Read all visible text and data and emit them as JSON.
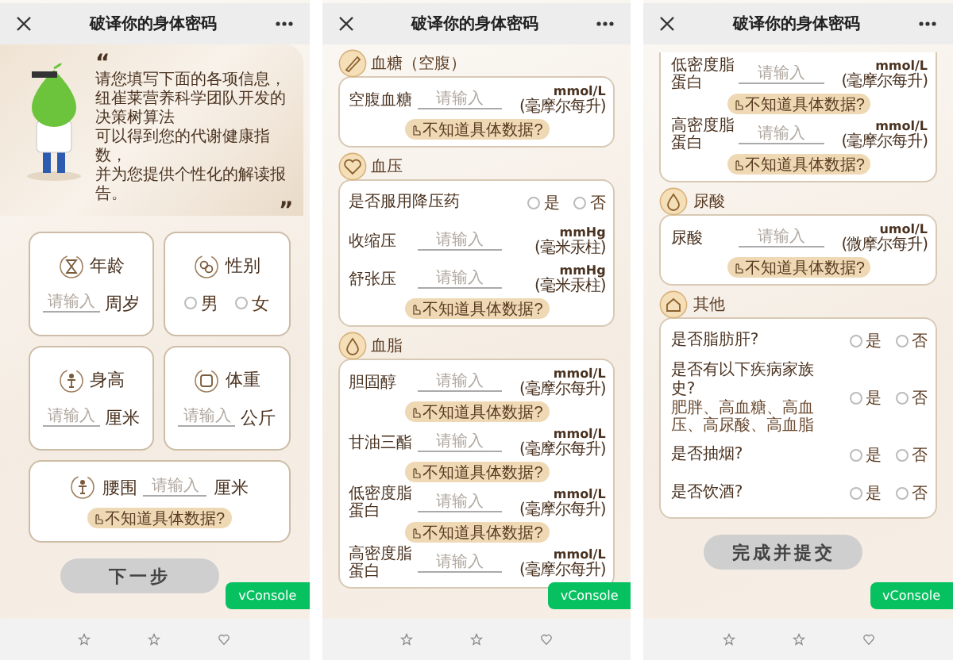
{
  "panels": [
    {
      "kind": "intro",
      "title": "破译你的身体密码",
      "quote_open": "“",
      "quote_close": "”",
      "quote_lines": [
        "请您填写下面的各项信息，",
        "纽崔莱营养科学团队开发的决策树算法",
        "可以得到您的代谢健康指数，",
        "并为您提供个性化的解读报告。"
      ],
      "cards": [
        {
          "kind": "input",
          "label": "年龄",
          "placeholder": "请输入",
          "unit": "周岁"
        },
        {
          "kind": "choice",
          "label": "性别",
          "options": [
            {
              "label": "男",
              "selected": false
            },
            {
              "label": "女",
              "selected": false
            }
          ]
        },
        {
          "kind": "input",
          "label": "身高",
          "placeholder": "请输入",
          "unit": "厘米"
        },
        {
          "kind": "input",
          "label": "体重",
          "placeholder": "请输入",
          "unit": "公斤"
        },
        {
          "kind": "wide_input",
          "label": "腰围",
          "placeholder": "请输入",
          "unit": "厘米",
          "hint": "不知道具体数据?"
        }
      ],
      "button": "下一步",
      "console": "vConsole"
    },
    {
      "kind": "form",
      "title": "破译你的身体密码",
      "sections": [
        {
          "kind": "glucose",
          "title": "血糖（空腹）",
          "rows": [
            {
              "kind": "measure",
              "label": "空腹血糖",
              "placeholder": "请输入",
              "unit": "mmol/L",
              "unit_note": "(毫摩尔每升)",
              "hint": "不知道具体数据?"
            }
          ]
        },
        {
          "kind": "pressure",
          "title": "血压",
          "rows": [
            {
              "kind": "choice",
              "label": "是否服用降压药",
              "options": [
                {
                  "label": "是",
                  "selected": false
                },
                {
                  "label": "否",
                  "selected": false
                }
              ]
            },
            {
              "kind": "measure",
              "label": "收缩压",
              "placeholder": "请输入",
              "unit": "mmHg",
              "unit_note": "(毫米汞柱)"
            },
            {
              "kind": "measure",
              "label": "舒张压",
              "placeholder": "请输入",
              "unit": "mmHg",
              "unit_note": "(毫米汞柱)",
              "hint": "不知道具体数据?"
            }
          ]
        },
        {
          "kind": "lipid",
          "title": "血脂",
          "rows": [
            {
              "kind": "measure",
              "label": "胆固醇",
              "placeholder": "请输入",
              "unit": "mmol/L",
              "unit_note": "(毫摩尔每升)",
              "hint": "不知道具体数据?"
            },
            {
              "kind": "measure",
              "label": "甘油三酯",
              "placeholder": "请输入",
              "unit": "mmol/L",
              "unit_note": "(毫摩尔每升)",
              "hint": "不知道具体数据?"
            },
            {
              "kind": "measure",
              "label": "低密度脂蛋白",
              "placeholder": "请输入",
              "unit": "mmol/L",
              "unit_note": "(毫摩尔每升)",
              "hint": "不知道具体数据?"
            },
            {
              "kind": "measure",
              "label": "高密度脂蛋白",
              "placeholder": "请输入",
              "unit": "mmol/L",
              "unit_note": "(毫摩尔每升)"
            }
          ]
        }
      ],
      "console": "vConsole"
    },
    {
      "kind": "form",
      "title": "破译你的身体密码",
      "sections": [
        {
          "rows": [
            {
              "kind": "measure",
              "label": "低密度脂蛋白",
              "placeholder": "请输入",
              "unit": "mmol/L",
              "unit_note": "(毫摩尔每升)",
              "hint": "不知道具体数据?"
            },
            {
              "kind": "measure",
              "label": "高密度脂蛋白",
              "placeholder": "请输入",
              "unit": "mmol/L",
              "unit_note": "(毫摩尔每升)",
              "hint": "不知道具体数据?"
            }
          ]
        },
        {
          "kind": "uric",
          "title": "尿酸",
          "rows": [
            {
              "kind": "measure",
              "label": "尿酸",
              "placeholder": "请输入",
              "unit": "umol/L",
              "unit_note": "(微摩尔每升)",
              "hint": "不知道具体数据?"
            }
          ]
        },
        {
          "kind": "other",
          "title": "其他",
          "rows": [
            {
              "kind": "choice",
              "label": "是否脂肪肝?",
              "options": [
                {
                  "label": "是",
                  "selected": false
                },
                {
                  "label": "否",
                  "selected": false
                }
              ]
            },
            {
              "kind": "choice",
              "label": "是否有以下疾病家族史?",
              "note": "肥胖、高血糖、高血压、高尿酸、高血脂",
              "options": [
                {
                  "label": "是",
                  "selected": false
                },
                {
                  "label": "否",
                  "selected": false
                }
              ]
            },
            {
              "kind": "choice",
              "label": "是否抽烟?",
              "options": [
                {
                  "label": "是",
                  "selected": false
                },
                {
                  "label": "否",
                  "selected": false
                }
              ]
            },
            {
              "kind": "choice",
              "label": "是否饮酒?",
              "options": [
                {
                  "label": "是",
                  "selected": false
                },
                {
                  "label": "否",
                  "selected": false
                }
              ]
            }
          ]
        }
      ],
      "button": "完成并提交",
      "console": "vConsole"
    }
  ]
}
